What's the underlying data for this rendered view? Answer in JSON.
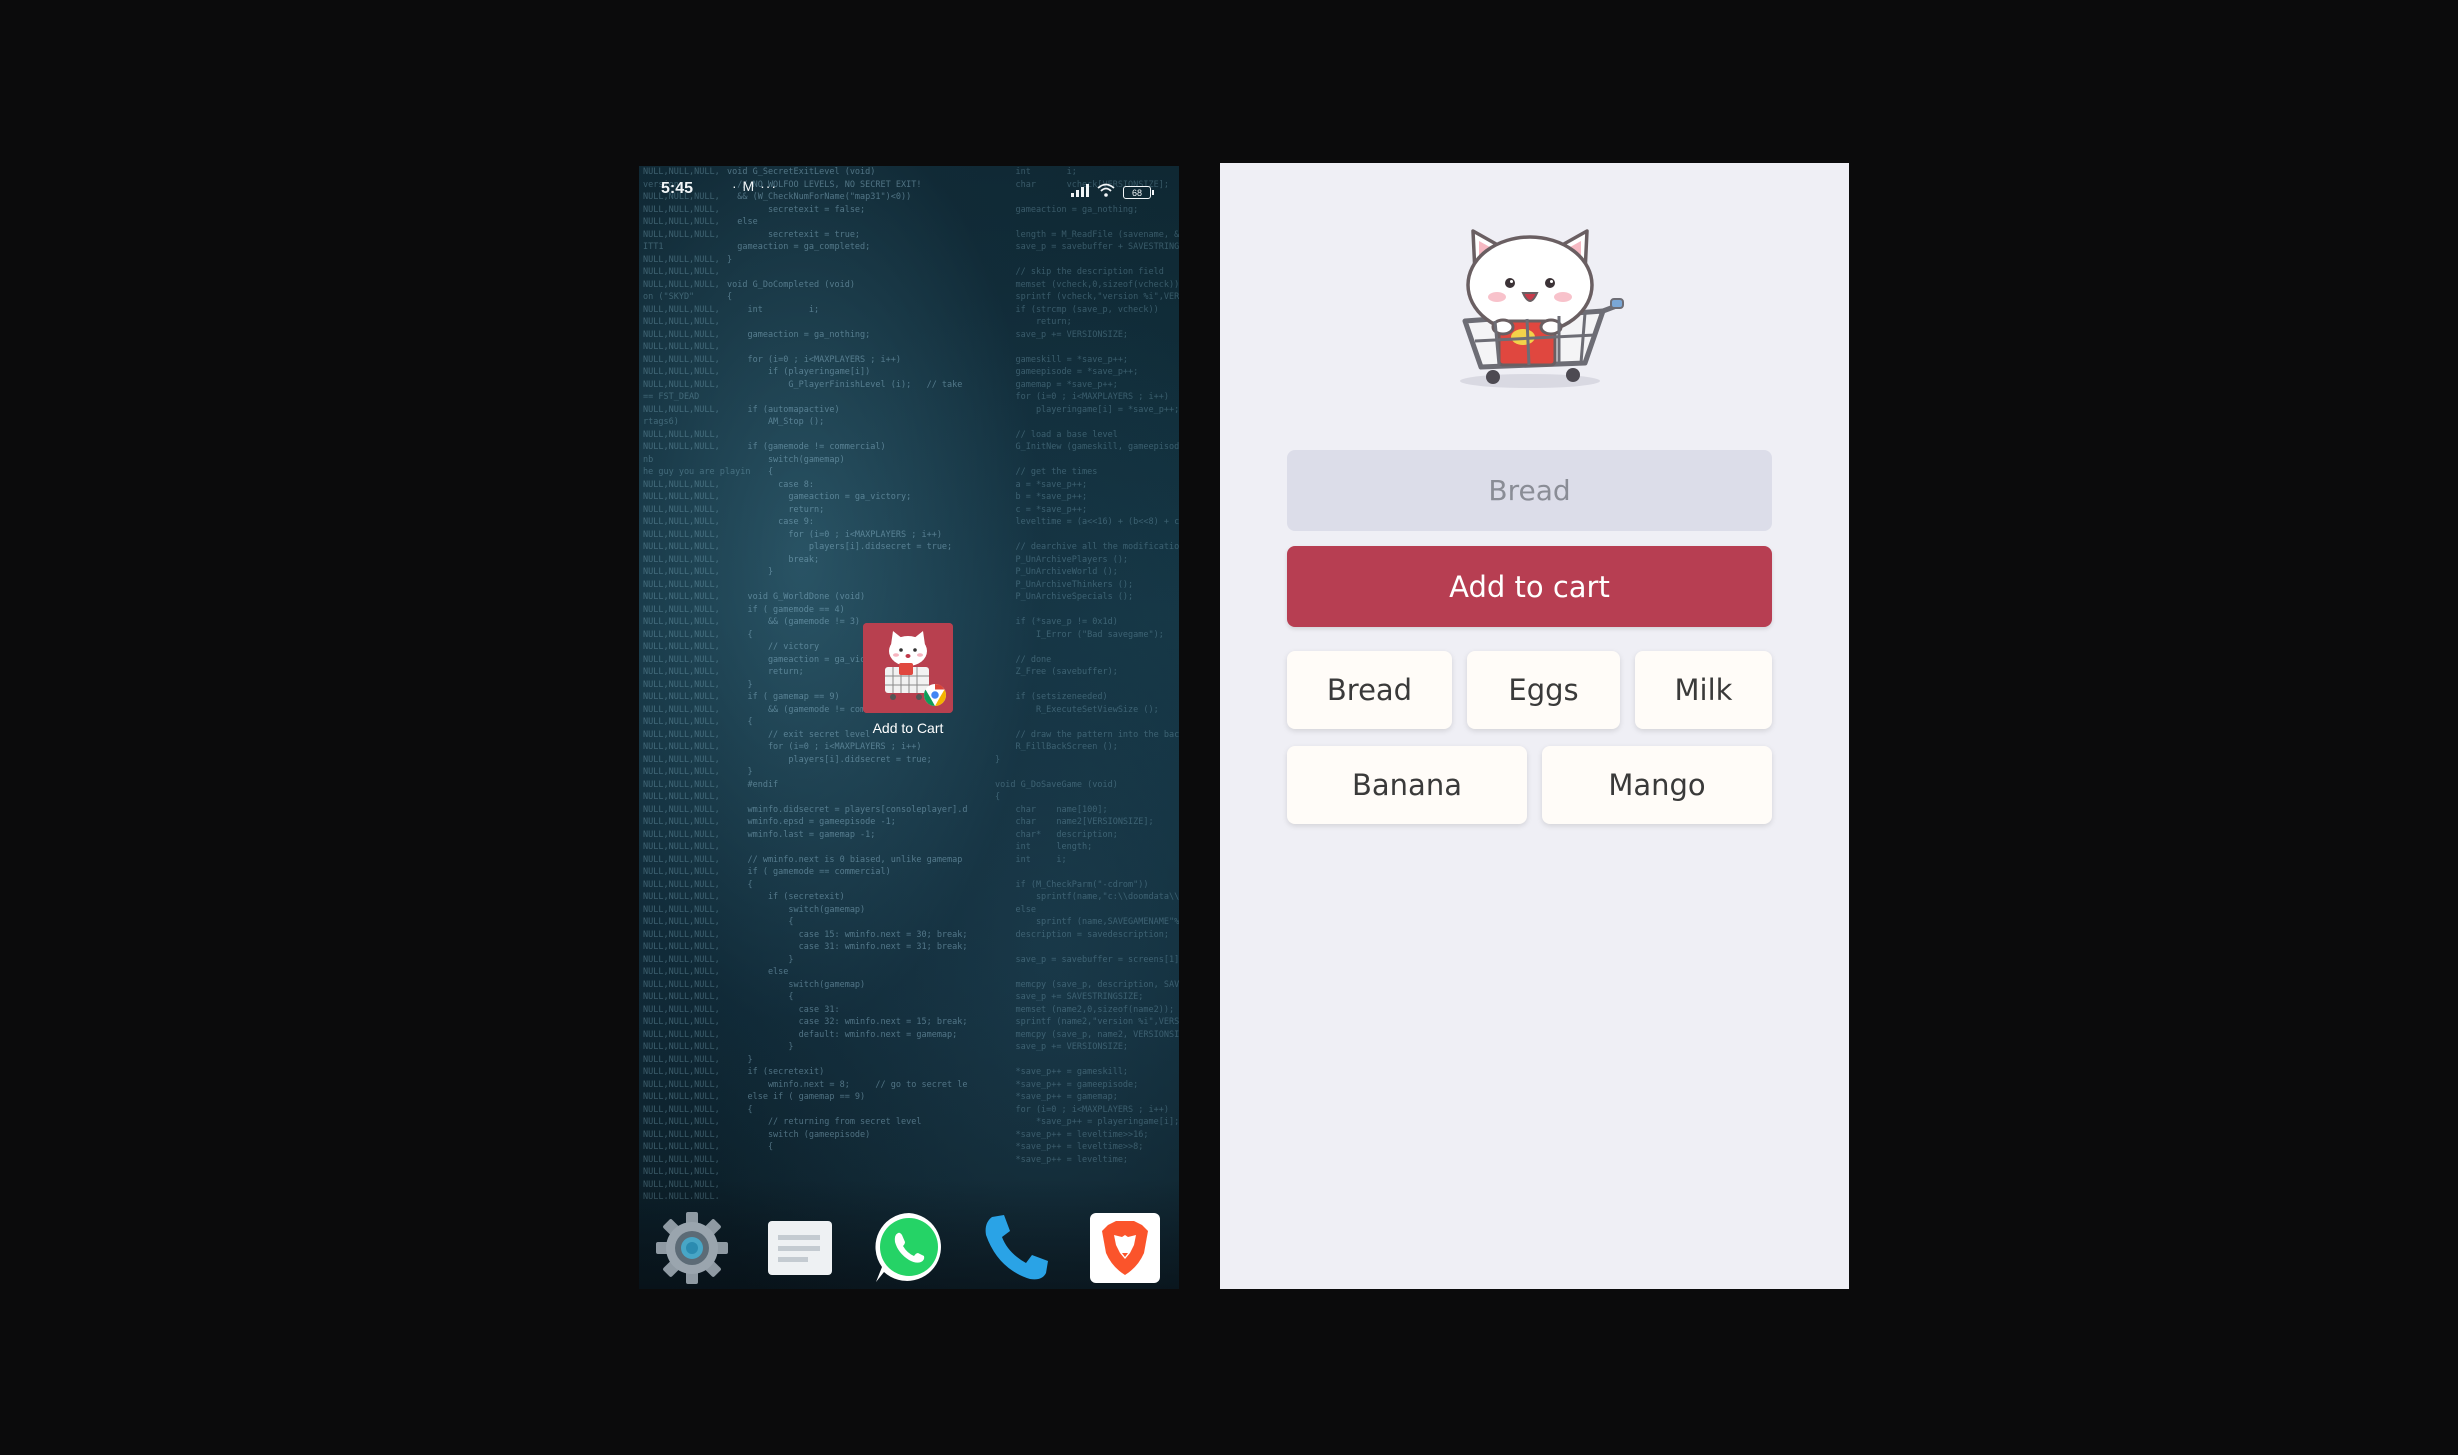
{
  "phone": {
    "status": {
      "time": "5:45",
      "battery": "68"
    },
    "home_app": {
      "label": "Add to Cart"
    },
    "dock": [
      {
        "name": "settings-icon"
      },
      {
        "name": "messages-icon"
      },
      {
        "name": "whatsapp-icon"
      },
      {
        "name": "phone-icon"
      },
      {
        "name": "brave-browser-icon"
      }
    ]
  },
  "web_app": {
    "input": {
      "value": "",
      "placeholder": "Bread"
    },
    "add_button_label": "Add to cart",
    "chips": [
      "Bread",
      "Eggs",
      "Milk",
      "Banana",
      "Mango"
    ]
  },
  "colors": {
    "brand": "#b73e52",
    "page_bg": "#efeff5",
    "input_bg": "#dcdde9",
    "chip_bg": "#fffcf8"
  }
}
